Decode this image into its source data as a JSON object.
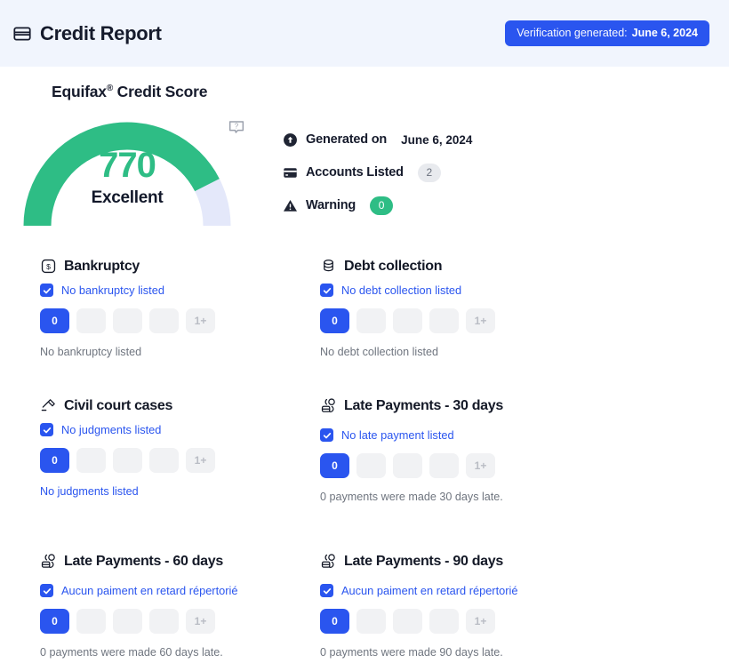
{
  "header": {
    "icon": "credit-card-icon",
    "title": "Credit Report",
    "badge": {
      "label": "Verification generated:",
      "date": "June 6, 2024",
      "color": "#2a55ef"
    }
  },
  "score": {
    "heading": "Equifax",
    "heading_sup": "®",
    "heading_rest": " Credit Score",
    "value": "770",
    "rating": "Excellent",
    "gauge_fill_percent": 85,
    "gauge_color": "#2ebd85",
    "gauge_track_color": "#e4e8fa",
    "help_icon": "question-bubble-icon"
  },
  "info": {
    "rows": [
      {
        "icon": "upload-circle-icon",
        "label": "Generated on",
        "value": "June 6, 2024",
        "badge": null,
        "badge_style": null
      },
      {
        "icon": "credit-card-icon",
        "label": "Accounts Listed",
        "value": null,
        "badge": "2",
        "badge_style": "gray"
      },
      {
        "icon": "warning-triangle-icon",
        "label": "Warning",
        "value": null,
        "badge": "0",
        "badge_style": "green"
      }
    ]
  },
  "cards": [
    {
      "icon": "dollar-square-icon",
      "title": "Bankruptcy",
      "check_label": "No bankruptcy listed",
      "scale": [
        "0",
        "",
        "",
        "",
        "1+"
      ],
      "active_index": 0,
      "footer": "No bankruptcy listed",
      "footer_blue": false
    },
    {
      "icon": "coin-stack-icon",
      "title": "Debt collection",
      "check_label": "No debt collection listed",
      "scale": [
        "0",
        "",
        "",
        "",
        "1+"
      ],
      "active_index": 0,
      "footer": "No debt collection listed",
      "footer_blue": false
    },
    {
      "icon": "gavel-icon",
      "title": "Civil court cases",
      "check_label": "No judgments listed",
      "scale": [
        "0",
        "",
        "",
        "",
        "1+"
      ],
      "active_index": 0,
      "footer": "No judgments listed",
      "footer_blue": true
    },
    {
      "icon": "late-payment-icon",
      "title": "Late Payments - 30 days",
      "check_label": "No late payment listed",
      "scale": [
        "0",
        "",
        "",
        "",
        "1+"
      ],
      "active_index": 0,
      "footer": "0 payments were made 30 days late.",
      "footer_blue": false
    },
    {
      "icon": "late-payment-icon",
      "title": "Late Payments - 60 days",
      "check_label": "Aucun paiment en retard répertorié",
      "scale": [
        "0",
        "",
        "",
        "",
        "1+"
      ],
      "active_index": 0,
      "footer": "0 payments were made 60 days late.",
      "footer_blue": false
    },
    {
      "icon": "late-payment-icon",
      "title": "Late Payments - 90 days",
      "check_label": "Aucun paiment en retard répertorié",
      "scale": [
        "0",
        "",
        "",
        "",
        "1+"
      ],
      "active_index": 0,
      "footer": "0 payments were made 90 days late.",
      "footer_blue": false
    }
  ]
}
